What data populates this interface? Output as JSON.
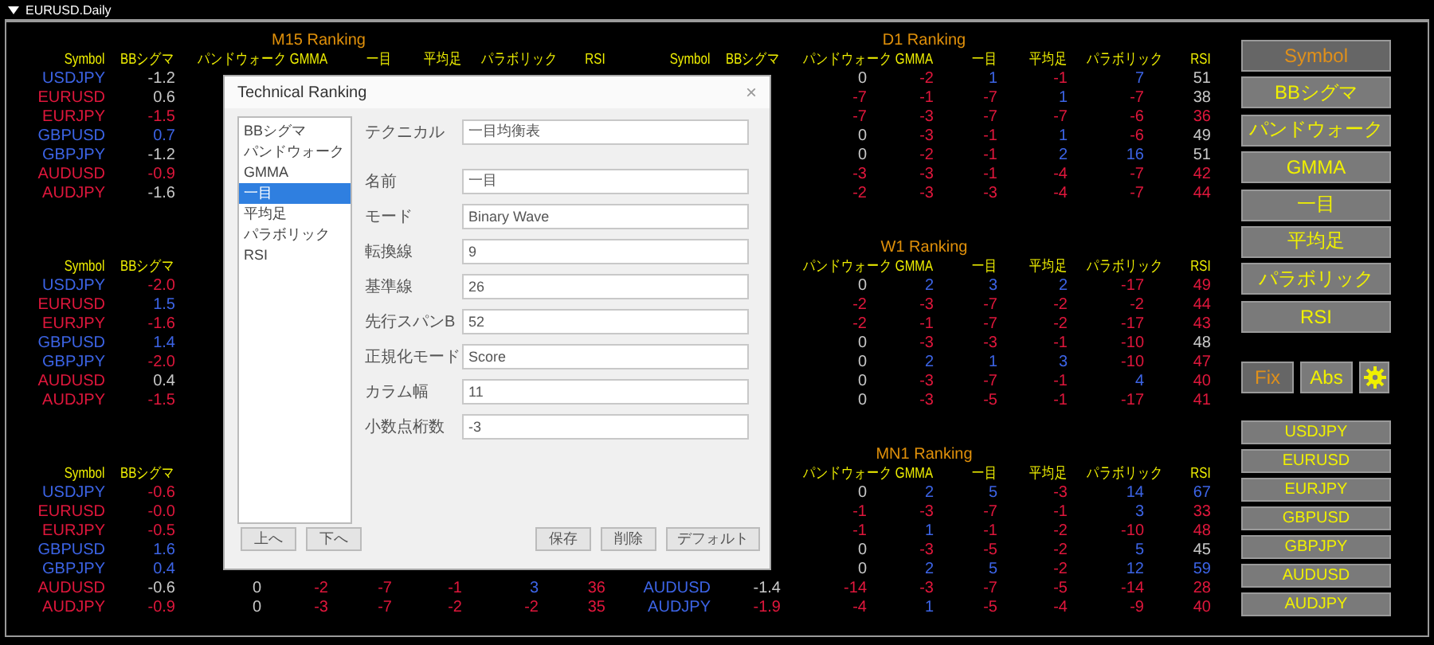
{
  "window": {
    "title": "EURUSD.Daily"
  },
  "tables": [
    {
      "title": "M15 Ranking",
      "columns": [
        "Symbol",
        "BBシグマ",
        "パンドウォーク",
        "GMMA",
        "一目",
        "平均足",
        "パラボリック",
        "RSI"
      ],
      "rows": [
        {
          "cells": [
            {
              "v": "USDJPY",
              "color": "#3c64e6"
            },
            {
              "v": "-1.2",
              "color": "#c8c8c8"
            },
            null,
            null,
            null,
            null,
            null,
            null
          ]
        },
        {
          "cells": [
            {
              "v": "EURUSD",
              "color": "#e0173c"
            },
            {
              "v": "0.6",
              "color": "#c8c8c8"
            },
            null,
            null,
            null,
            null,
            null,
            null
          ]
        },
        {
          "cells": [
            {
              "v": "EURJPY",
              "color": "#e0173c"
            },
            {
              "v": "-1.5",
              "color": "#e0173c"
            },
            null,
            null,
            null,
            null,
            null,
            null
          ]
        },
        {
          "cells": [
            {
              "v": "GBPUSD",
              "color": "#3c64e6"
            },
            {
              "v": "0.7",
              "color": "#3c64e6"
            },
            null,
            null,
            null,
            null,
            null,
            null
          ]
        },
        {
          "cells": [
            {
              "v": "GBPJPY",
              "color": "#3c64e6"
            },
            {
              "v": "-1.2",
              "color": "#c8c8c8"
            },
            null,
            null,
            null,
            null,
            null,
            null
          ]
        },
        {
          "cells": [
            {
              "v": "AUDUSD",
              "color": "#e0173c"
            },
            {
              "v": "-0.9",
              "color": "#e0173c"
            },
            null,
            null,
            null,
            null,
            null,
            null
          ]
        },
        {
          "cells": [
            {
              "v": "AUDJPY",
              "color": "#e0173c"
            },
            {
              "v": "-1.6",
              "color": "#c8c8c8"
            },
            null,
            null,
            null,
            null,
            null,
            null
          ]
        }
      ]
    },
    {
      "title": "D1 Ranking",
      "columns": [
        "Symbol",
        "BBシグマ",
        "パンドウォーク",
        "GMMA",
        "一目",
        "平均足",
        "パラボリック",
        "RSI"
      ],
      "rows": [
        {
          "cells": [
            null,
            null,
            {
              "v": "0",
              "color": "#c8c8c8"
            },
            {
              "v": "-2",
              "color": "#e0173c"
            },
            {
              "v": "1",
              "color": "#3c64e6"
            },
            {
              "v": "-1",
              "color": "#e0173c"
            },
            {
              "v": "7",
              "color": "#3c64e6"
            },
            {
              "v": "51",
              "color": "#c8c8c8"
            }
          ]
        },
        {
          "cells": [
            null,
            null,
            {
              "v": "-7",
              "color": "#e0173c"
            },
            {
              "v": "-1",
              "color": "#e0173c"
            },
            {
              "v": "-7",
              "color": "#e0173c"
            },
            {
              "v": "1",
              "color": "#3c64e6"
            },
            {
              "v": "-7",
              "color": "#e0173c"
            },
            {
              "v": "38",
              "color": "#c8c8c8"
            }
          ]
        },
        {
          "cells": [
            null,
            null,
            {
              "v": "-7",
              "color": "#e0173c"
            },
            {
              "v": "-3",
              "color": "#e0173c"
            },
            {
              "v": "-7",
              "color": "#e0173c"
            },
            {
              "v": "-7",
              "color": "#e0173c"
            },
            {
              "v": "-6",
              "color": "#e0173c"
            },
            {
              "v": "36",
              "color": "#e0173c"
            }
          ]
        },
        {
          "cells": [
            null,
            null,
            {
              "v": "0",
              "color": "#c8c8c8"
            },
            {
              "v": "-3",
              "color": "#e0173c"
            },
            {
              "v": "-1",
              "color": "#e0173c"
            },
            {
              "v": "1",
              "color": "#3c64e6"
            },
            {
              "v": "-6",
              "color": "#e0173c"
            },
            {
              "v": "49",
              "color": "#c8c8c8"
            }
          ]
        },
        {
          "cells": [
            null,
            null,
            {
              "v": "0",
              "color": "#c8c8c8"
            },
            {
              "v": "-2",
              "color": "#e0173c"
            },
            {
              "v": "-1",
              "color": "#e0173c"
            },
            {
              "v": "2",
              "color": "#3c64e6"
            },
            {
              "v": "16",
              "color": "#3c64e6"
            },
            {
              "v": "51",
              "color": "#c8c8c8"
            }
          ]
        },
        {
          "cells": [
            null,
            null,
            {
              "v": "-3",
              "color": "#e0173c"
            },
            {
              "v": "-3",
              "color": "#e0173c"
            },
            {
              "v": "-1",
              "color": "#e0173c"
            },
            {
              "v": "-4",
              "color": "#e0173c"
            },
            {
              "v": "-7",
              "color": "#e0173c"
            },
            {
              "v": "42",
              "color": "#e0173c"
            }
          ]
        },
        {
          "cells": [
            null,
            null,
            {
              "v": "-2",
              "color": "#e0173c"
            },
            {
              "v": "-3",
              "color": "#e0173c"
            },
            {
              "v": "-3",
              "color": "#e0173c"
            },
            {
              "v": "-4",
              "color": "#e0173c"
            },
            {
              "v": "-7",
              "color": "#e0173c"
            },
            {
              "v": "44",
              "color": "#e0173c"
            }
          ]
        }
      ]
    },
    {
      "columns": [
        "Symbol",
        "BBシグマ",
        null,
        null,
        null,
        null,
        null,
        null
      ],
      "rows": [
        {
          "cells": [
            {
              "v": "USDJPY",
              "color": "#3c64e6"
            },
            {
              "v": "-2.0",
              "color": "#e0173c"
            },
            null,
            null,
            null,
            null,
            null,
            null
          ]
        },
        {
          "cells": [
            {
              "v": "EURUSD",
              "color": "#e0173c"
            },
            {
              "v": "1.5",
              "color": "#3c64e6"
            },
            null,
            null,
            null,
            null,
            null,
            null
          ]
        },
        {
          "cells": [
            {
              "v": "EURJPY",
              "color": "#e0173c"
            },
            {
              "v": "-1.6",
              "color": "#e0173c"
            },
            null,
            null,
            null,
            null,
            null,
            null
          ]
        },
        {
          "cells": [
            {
              "v": "GBPUSD",
              "color": "#3c64e6"
            },
            {
              "v": "1.4",
              "color": "#3c64e6"
            },
            null,
            null,
            null,
            null,
            null,
            null
          ]
        },
        {
          "cells": [
            {
              "v": "GBPJPY",
              "color": "#3c64e6"
            },
            {
              "v": "-2.0",
              "color": "#e0173c"
            },
            null,
            null,
            null,
            null,
            null,
            null
          ]
        },
        {
          "cells": [
            {
              "v": "AUDUSD",
              "color": "#e0173c"
            },
            {
              "v": "0.4",
              "color": "#c8c8c8"
            },
            null,
            null,
            null,
            null,
            null,
            null
          ]
        },
        {
          "cells": [
            {
              "v": "AUDJPY",
              "color": "#e0173c"
            },
            {
              "v": "-1.5",
              "color": "#e0173c"
            },
            null,
            null,
            null,
            null,
            null,
            null
          ]
        }
      ]
    },
    {
      "title": "W1 Ranking",
      "columns": [
        null,
        null,
        "パンドウォーク",
        "GMMA",
        "一目",
        "平均足",
        "パラボリック",
        "RSI"
      ],
      "rows": [
        {
          "cells": [
            null,
            null,
            {
              "v": "0",
              "color": "#c8c8c8"
            },
            {
              "v": "2",
              "color": "#3c64e6"
            },
            {
              "v": "3",
              "color": "#3c64e6"
            },
            {
              "v": "2",
              "color": "#3c64e6"
            },
            {
              "v": "-17",
              "color": "#e0173c"
            },
            {
              "v": "49",
              "color": "#e0173c"
            }
          ]
        },
        {
          "cells": [
            null,
            null,
            {
              "v": "-2",
              "color": "#e0173c"
            },
            {
              "v": "-3",
              "color": "#e0173c"
            },
            {
              "v": "-7",
              "color": "#e0173c"
            },
            {
              "v": "-2",
              "color": "#e0173c"
            },
            {
              "v": "-2",
              "color": "#e0173c"
            },
            {
              "v": "44",
              "color": "#e0173c"
            }
          ]
        },
        {
          "cells": [
            null,
            null,
            {
              "v": "-2",
              "color": "#e0173c"
            },
            {
              "v": "-1",
              "color": "#e0173c"
            },
            {
              "v": "-7",
              "color": "#e0173c"
            },
            {
              "v": "-2",
              "color": "#e0173c"
            },
            {
              "v": "-17",
              "color": "#e0173c"
            },
            {
              "v": "43",
              "color": "#e0173c"
            }
          ]
        },
        {
          "cells": [
            null,
            null,
            {
              "v": "0",
              "color": "#c8c8c8"
            },
            {
              "v": "-3",
              "color": "#e0173c"
            },
            {
              "v": "-3",
              "color": "#e0173c"
            },
            {
              "v": "-1",
              "color": "#e0173c"
            },
            {
              "v": "-10",
              "color": "#e0173c"
            },
            {
              "v": "48",
              "color": "#c8c8c8"
            }
          ]
        },
        {
          "cells": [
            null,
            null,
            {
              "v": "0",
              "color": "#c8c8c8"
            },
            {
              "v": "2",
              "color": "#3c64e6"
            },
            {
              "v": "1",
              "color": "#3c64e6"
            },
            {
              "v": "3",
              "color": "#3c64e6"
            },
            {
              "v": "-10",
              "color": "#e0173c"
            },
            {
              "v": "47",
              "color": "#e0173c"
            }
          ]
        },
        {
          "cells": [
            null,
            null,
            {
              "v": "0",
              "color": "#c8c8c8"
            },
            {
              "v": "-3",
              "color": "#e0173c"
            },
            {
              "v": "-7",
              "color": "#e0173c"
            },
            {
              "v": "-1",
              "color": "#e0173c"
            },
            {
              "v": "4",
              "color": "#3c64e6"
            },
            {
              "v": "40",
              "color": "#e0173c"
            }
          ]
        },
        {
          "cells": [
            null,
            null,
            {
              "v": "0",
              "color": "#c8c8c8"
            },
            {
              "v": "-3",
              "color": "#e0173c"
            },
            {
              "v": "-5",
              "color": "#e0173c"
            },
            {
              "v": "-1",
              "color": "#e0173c"
            },
            {
              "v": "-17",
              "color": "#e0173c"
            },
            {
              "v": "41",
              "color": "#e0173c"
            }
          ]
        }
      ]
    },
    {
      "columns": [
        "Symbol",
        "BBシグマ",
        null,
        null,
        null,
        null,
        null,
        null
      ],
      "rows": [
        {
          "cells": [
            {
              "v": "USDJPY",
              "color": "#3c64e6"
            },
            {
              "v": "-0.6",
              "color": "#e0173c"
            },
            null,
            null,
            null,
            null,
            null,
            null
          ]
        },
        {
          "cells": [
            {
              "v": "EURUSD",
              "color": "#e0173c"
            },
            {
              "v": "-0.0",
              "color": "#e0173c"
            },
            null,
            null,
            null,
            null,
            null,
            null
          ]
        },
        {
          "cells": [
            {
              "v": "EURJPY",
              "color": "#e0173c"
            },
            {
              "v": "-0.5",
              "color": "#e0173c"
            },
            null,
            null,
            null,
            null,
            null,
            null
          ]
        },
        {
          "cells": [
            {
              "v": "GBPUSD",
              "color": "#3c64e6"
            },
            {
              "v": "1.6",
              "color": "#3c64e6"
            },
            null,
            null,
            null,
            null,
            null,
            null
          ]
        },
        {
          "cells": [
            {
              "v": "GBPJPY",
              "color": "#3c64e6"
            },
            {
              "v": "0.4",
              "color": "#3c64e6"
            },
            null,
            null,
            null,
            null,
            null,
            null
          ]
        },
        {
          "cells": [
            {
              "v": "AUDUSD",
              "color": "#e0173c"
            },
            {
              "v": "-0.6",
              "color": "#c8c8c8"
            },
            {
              "v": "0",
              "color": "#c8c8c8"
            },
            {
              "v": "-2",
              "color": "#e0173c"
            },
            {
              "v": "-7",
              "color": "#e0173c"
            },
            {
              "v": "-1",
              "color": "#e0173c"
            },
            {
              "v": "3",
              "color": "#3c64e6"
            },
            {
              "v": "36",
              "color": "#e0173c"
            }
          ]
        },
        {
          "cells": [
            {
              "v": "AUDJPY",
              "color": "#e0173c"
            },
            {
              "v": "-0.9",
              "color": "#e0173c"
            },
            {
              "v": "0",
              "color": "#c8c8c8"
            },
            {
              "v": "-3",
              "color": "#e0173c"
            },
            {
              "v": "-7",
              "color": "#e0173c"
            },
            {
              "v": "-2",
              "color": "#e0173c"
            },
            {
              "v": "-2",
              "color": "#e0173c"
            },
            {
              "v": "35",
              "color": "#e0173c"
            }
          ]
        }
      ]
    },
    {
      "title": "MN1 Ranking",
      "columns": [
        null,
        null,
        "パンドウォーク",
        "GMMA",
        "一目",
        "平均足",
        "パラボリック",
        "RSI"
      ],
      "rows": [
        {
          "cells": [
            null,
            null,
            {
              "v": "0",
              "color": "#c8c8c8"
            },
            {
              "v": "2",
              "color": "#3c64e6"
            },
            {
              "v": "5",
              "color": "#3c64e6"
            },
            {
              "v": "-3",
              "color": "#e0173c"
            },
            {
              "v": "14",
              "color": "#3c64e6"
            },
            {
              "v": "67",
              "color": "#3c64e6"
            }
          ]
        },
        {
          "cells": [
            null,
            null,
            {
              "v": "-1",
              "color": "#e0173c"
            },
            {
              "v": "-3",
              "color": "#e0173c"
            },
            {
              "v": "-7",
              "color": "#e0173c"
            },
            {
              "v": "-1",
              "color": "#e0173c"
            },
            {
              "v": "3",
              "color": "#3c64e6"
            },
            {
              "v": "33",
              "color": "#e0173c"
            }
          ]
        },
        {
          "cells": [
            null,
            null,
            {
              "v": "-1",
              "color": "#e0173c"
            },
            {
              "v": "1",
              "color": "#3c64e6"
            },
            {
              "v": "-1",
              "color": "#e0173c"
            },
            {
              "v": "-2",
              "color": "#e0173c"
            },
            {
              "v": "-10",
              "color": "#e0173c"
            },
            {
              "v": "48",
              "color": "#e0173c"
            }
          ]
        },
        {
          "cells": [
            null,
            null,
            {
              "v": "0",
              "color": "#c8c8c8"
            },
            {
              "v": "-3",
              "color": "#e0173c"
            },
            {
              "v": "-5",
              "color": "#e0173c"
            },
            {
              "v": "-2",
              "color": "#e0173c"
            },
            {
              "v": "5",
              "color": "#3c64e6"
            },
            {
              "v": "45",
              "color": "#c8c8c8"
            }
          ]
        },
        {
          "cells": [
            null,
            null,
            {
              "v": "0",
              "color": "#c8c8c8"
            },
            {
              "v": "2",
              "color": "#3c64e6"
            },
            {
              "v": "5",
              "color": "#3c64e6"
            },
            {
              "v": "-2",
              "color": "#e0173c"
            },
            {
              "v": "12",
              "color": "#3c64e6"
            },
            {
              "v": "59",
              "color": "#3c64e6"
            }
          ]
        },
        {
          "cells": [
            {
              "v": "AUDUSD",
              "color": "#3c64e6"
            },
            {
              "v": "-1.4",
              "color": "#c8c8c8"
            },
            {
              "v": "-14",
              "color": "#e0173c"
            },
            {
              "v": "-3",
              "color": "#e0173c"
            },
            {
              "v": "-7",
              "color": "#e0173c"
            },
            {
              "v": "-5",
              "color": "#e0173c"
            },
            {
              "v": "-14",
              "color": "#e0173c"
            },
            {
              "v": "28",
              "color": "#e0173c"
            }
          ]
        },
        {
          "cells": [
            {
              "v": "AUDJPY",
              "color": "#3c64e6"
            },
            {
              "v": "-1.9",
              "color": "#e0173c"
            },
            {
              "v": "-4",
              "color": "#e0173c"
            },
            {
              "v": "1",
              "color": "#3c64e6"
            },
            {
              "v": "-5",
              "color": "#e0173c"
            },
            {
              "v": "-4",
              "color": "#e0173c"
            },
            {
              "v": "-9",
              "color": "#e0173c"
            },
            {
              "v": "40",
              "color": "#e0173c"
            }
          ]
        }
      ]
    }
  ],
  "sort_buttons": [
    {
      "label": "Symbol",
      "selected": true
    },
    {
      "label": "BBシグマ",
      "selected": false
    },
    {
      "label": "パンドウォーク",
      "selected": false
    },
    {
      "label": "GMMA",
      "selected": false
    },
    {
      "label": "一目",
      "selected": false
    },
    {
      "label": "平均足",
      "selected": false
    },
    {
      "label": "パラボリック",
      "selected": false
    },
    {
      "label": "RSI",
      "selected": false
    }
  ],
  "option_buttons": [
    {
      "label": "Fix",
      "on": true
    },
    {
      "label": "Abs",
      "on": false
    }
  ],
  "symbol_buttons": [
    "USDJPY",
    "EURUSD",
    "EURJPY",
    "GBPUSD",
    "GBPJPY",
    "AUDUSD",
    "AUDJPY"
  ],
  "dialog": {
    "title": "Technical Ranking",
    "close": "×",
    "list": [
      {
        "label": "BBシグマ",
        "selected": false
      },
      {
        "label": "パンドウォーク",
        "selected": false
      },
      {
        "label": "GMMA",
        "selected": false
      },
      {
        "label": "一目",
        "selected": true
      },
      {
        "label": "平均足",
        "selected": false
      },
      {
        "label": "パラボリック",
        "selected": false
      },
      {
        "label": "RSI",
        "selected": false
      }
    ],
    "fields": [
      {
        "label": "テクニカル",
        "value": "一目均衡表"
      },
      {
        "label": "名前",
        "value": "一目"
      },
      {
        "label": "モード",
        "value": "Binary Wave"
      },
      {
        "label": "転換線",
        "value": "9"
      },
      {
        "label": "基準線",
        "value": "26"
      },
      {
        "label": "先行スパンB",
        "value": "52"
      },
      {
        "label": "正規化モード",
        "value": "Score"
      },
      {
        "label": "カラム幅",
        "value": "11"
      },
      {
        "label": "小数点桁数",
        "value": "-3"
      }
    ],
    "list_buttons": [
      "上へ",
      "下へ"
    ],
    "action_buttons": [
      "保存",
      "削除",
      "デフォルト"
    ]
  }
}
